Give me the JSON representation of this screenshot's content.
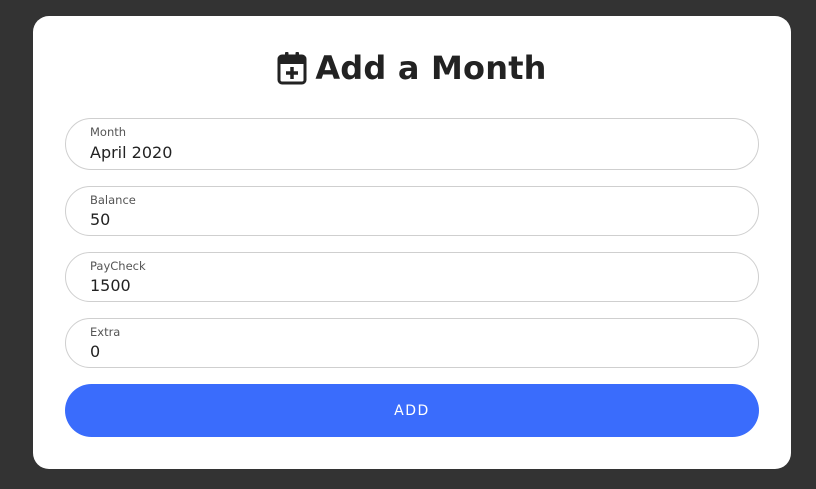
{
  "modal": {
    "title": "Add a Month",
    "title_icon": "calendar-plus-icon"
  },
  "fields": {
    "month": {
      "label": "Month",
      "value": "April 2020"
    },
    "balance": {
      "label": "Balance",
      "value": "50"
    },
    "paycheck": {
      "label": "PayCheck",
      "value": "1500"
    },
    "extra": {
      "label": "Extra",
      "value": "0"
    }
  },
  "actions": {
    "add_label": "ADD"
  },
  "colors": {
    "backdrop": "#333333",
    "card": "#ffffff",
    "accent": "#3a6cfc",
    "text": "#222222",
    "border": "#cfcfcf"
  }
}
